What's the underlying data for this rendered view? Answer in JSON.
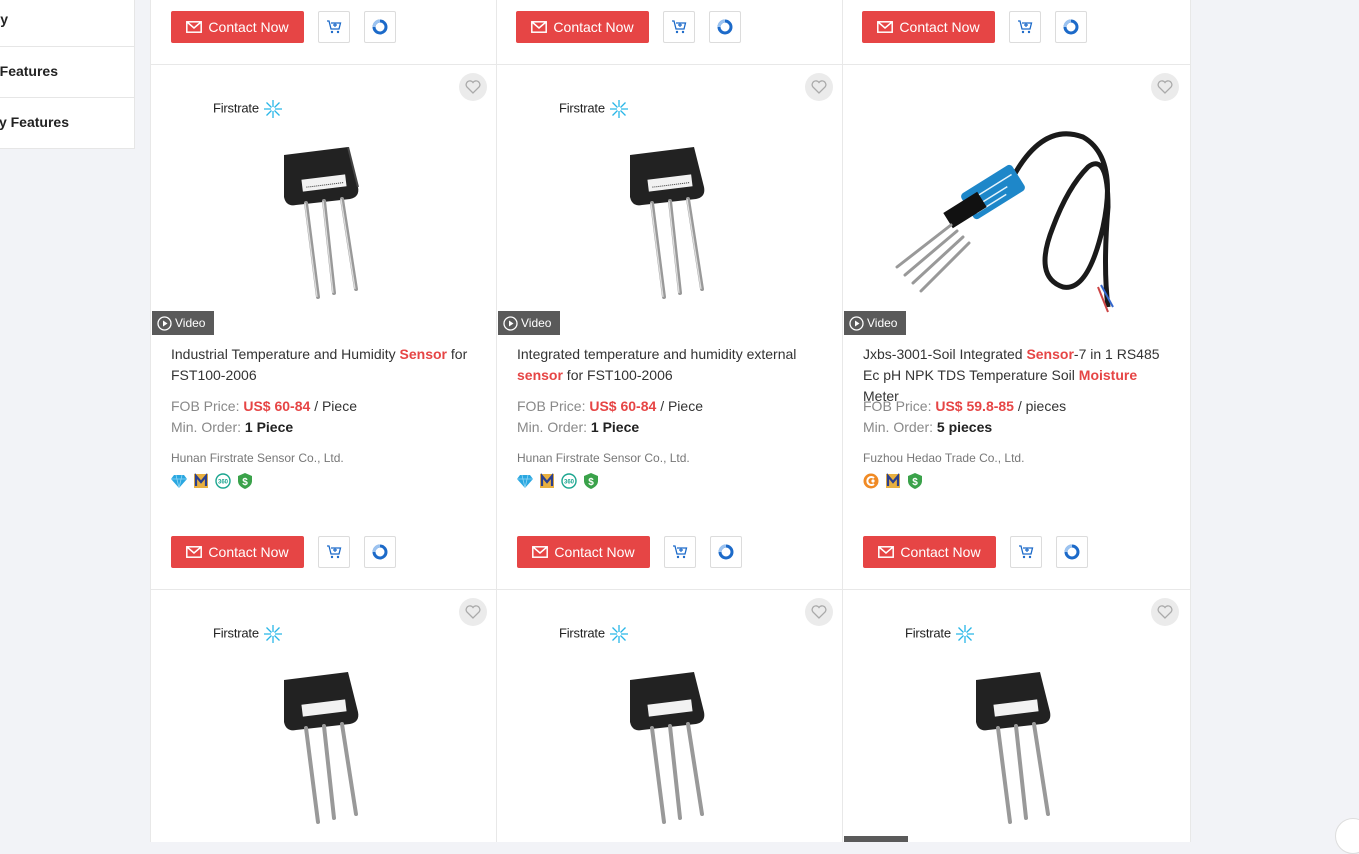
{
  "sidebar": {
    "items": [
      {
        "label": "Category"
      },
      {
        "label": "Product Features"
      },
      {
        "label": "Company Features"
      }
    ]
  },
  "actions": {
    "contact_label": "Contact Now"
  },
  "colors": {
    "accent": "#e64545",
    "video_tag": "#5a5a5a",
    "chat_blue": "#1c6ac9"
  },
  "products": [
    {
      "brand_logo": "Firstrate",
      "image": "soil-sensor-black-3-probe",
      "video_label": "Video",
      "title_parts": [
        {
          "text": "Industrial Temperature and Humidity ",
          "hl": false
        },
        {
          "text": "Sensor",
          "hl": true
        },
        {
          "text": " for FST100-2006",
          "hl": false
        }
      ],
      "price_label": "FOB Price:",
      "price": "US$ 60-84",
      "unit": "/ Piece",
      "min_order_label": "Min. Order:",
      "min_order": "1 Piece",
      "company": "Hunan Firstrate Sensor Co., Ltd.",
      "badges": [
        "diamond-icon",
        "audited-supplier-icon",
        "360-icon",
        "secured-trading-icon"
      ]
    },
    {
      "brand_logo": "Firstrate",
      "image": "soil-sensor-black-3-probe",
      "video_label": "Video",
      "title_parts": [
        {
          "text": "Integrated temperature and humidity external ",
          "hl": false
        },
        {
          "text": "sensor",
          "hl": true
        },
        {
          "text": " for FST100-2006",
          "hl": false
        }
      ],
      "price_label": "FOB Price:",
      "price": "US$ 60-84",
      "unit": "/ Piece",
      "min_order_label": "Min. Order:",
      "min_order": "1 Piece",
      "company": "Hunan Firstrate Sensor Co., Ltd.",
      "badges": [
        "diamond-icon",
        "audited-supplier-icon",
        "360-icon",
        "secured-trading-icon"
      ]
    },
    {
      "brand_logo": "",
      "image": "soil-integrated-sensor-blue-cable",
      "video_label": "Video",
      "title_parts": [
        {
          "text": "Jxbs-3001-Soil Integrated ",
          "hl": false
        },
        {
          "text": "Sensor",
          "hl": true
        },
        {
          "text": "-7 in 1 RS485 Ec pH NPK TDS Temperature Soil ",
          "hl": false
        },
        {
          "text": "Moisture",
          "hl": true
        },
        {
          "text": " Meter",
          "hl": false
        }
      ],
      "price_label": "FOB Price:",
      "price": "US$ 59.8-85",
      "unit": "/ pieces",
      "min_order_label": "Min. Order:",
      "min_order": "5 pieces",
      "company": "Fuzhou Hedao Trade Co., Ltd.",
      "badges": [
        "gold-member-icon",
        "audited-supplier-icon",
        "secured-trading-icon"
      ]
    }
  ],
  "next_row": [
    {
      "brand_logo": "Firstrate",
      "image": "soil-sensor-black-3-probe"
    },
    {
      "brand_logo": "Firstrate",
      "image": "soil-sensor-black-3-probe"
    },
    {
      "brand_logo": "Firstrate",
      "image": "soil-sensor-black-3-probe"
    }
  ]
}
